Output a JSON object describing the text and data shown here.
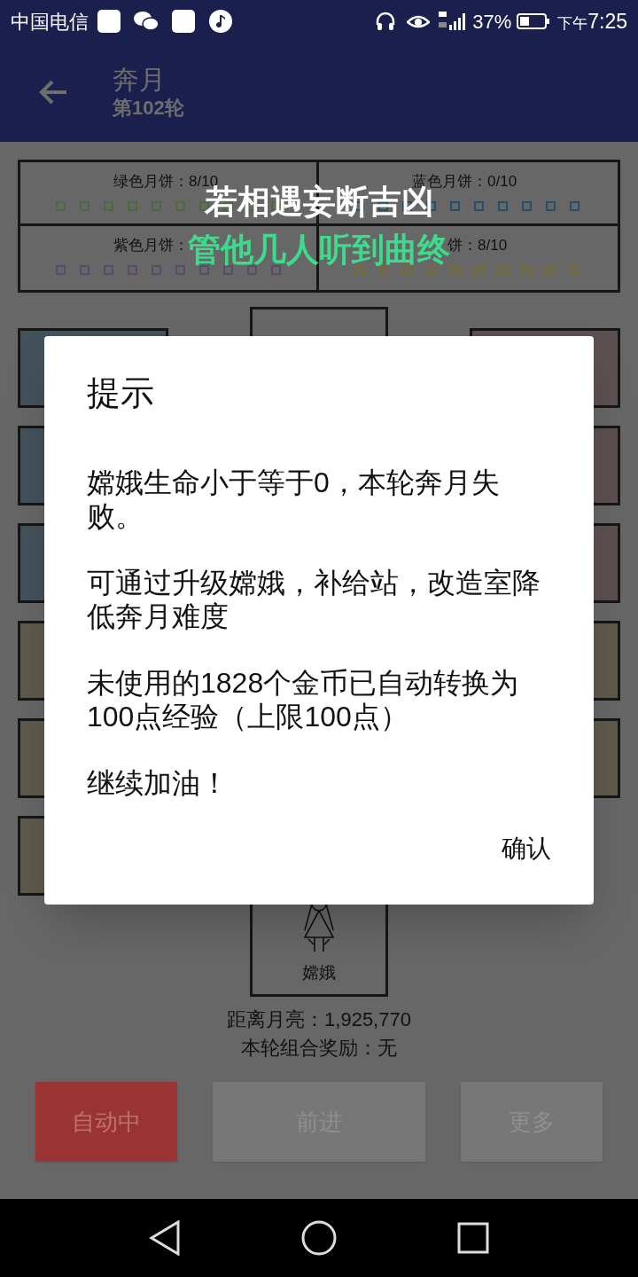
{
  "status_bar": {
    "carrier": "中国电信",
    "battery": "37%",
    "time_prefix": "下午",
    "time": "7:25"
  },
  "app_bar": {
    "title": "奔月",
    "subtitle": "第102轮"
  },
  "mooncakes": [
    {
      "label": "绿色月饼：8/10",
      "color": "#4b6b3c"
    },
    {
      "label": "蓝色月饼：0/10",
      "color": "#22506c"
    },
    {
      "label": "紫色月饼：",
      "color": "#5b4a6b"
    },
    {
      "label": "饼：8/10",
      "color": "#7a6a30"
    }
  ],
  "lyrics": [
    {
      "text": "若相遇妄断吉凶",
      "kind": "upcoming"
    },
    {
      "text": "管他几人听到曲终",
      "kind": "current"
    }
  ],
  "player": {
    "label": "嫦娥"
  },
  "distance": "距离月亮：1,925,770",
  "combo": "本轮组合奖励：无",
  "buttons": [
    {
      "label": "自动中",
      "kind": "active"
    },
    {
      "label": "前进",
      "kind": "plain"
    },
    {
      "label": "更多",
      "kind": "plain"
    }
  ],
  "dialog": {
    "title": "提示",
    "paragraphs": [
      "嫦娥生命小于等于0，本轮奔月失败。",
      "可通过升级嫦娥，补给站，改造室降低奔月难度",
      "未使用的1828个金币已自动转换为100点经验（上限100点）",
      "继续加油！"
    ],
    "button": "确认"
  }
}
